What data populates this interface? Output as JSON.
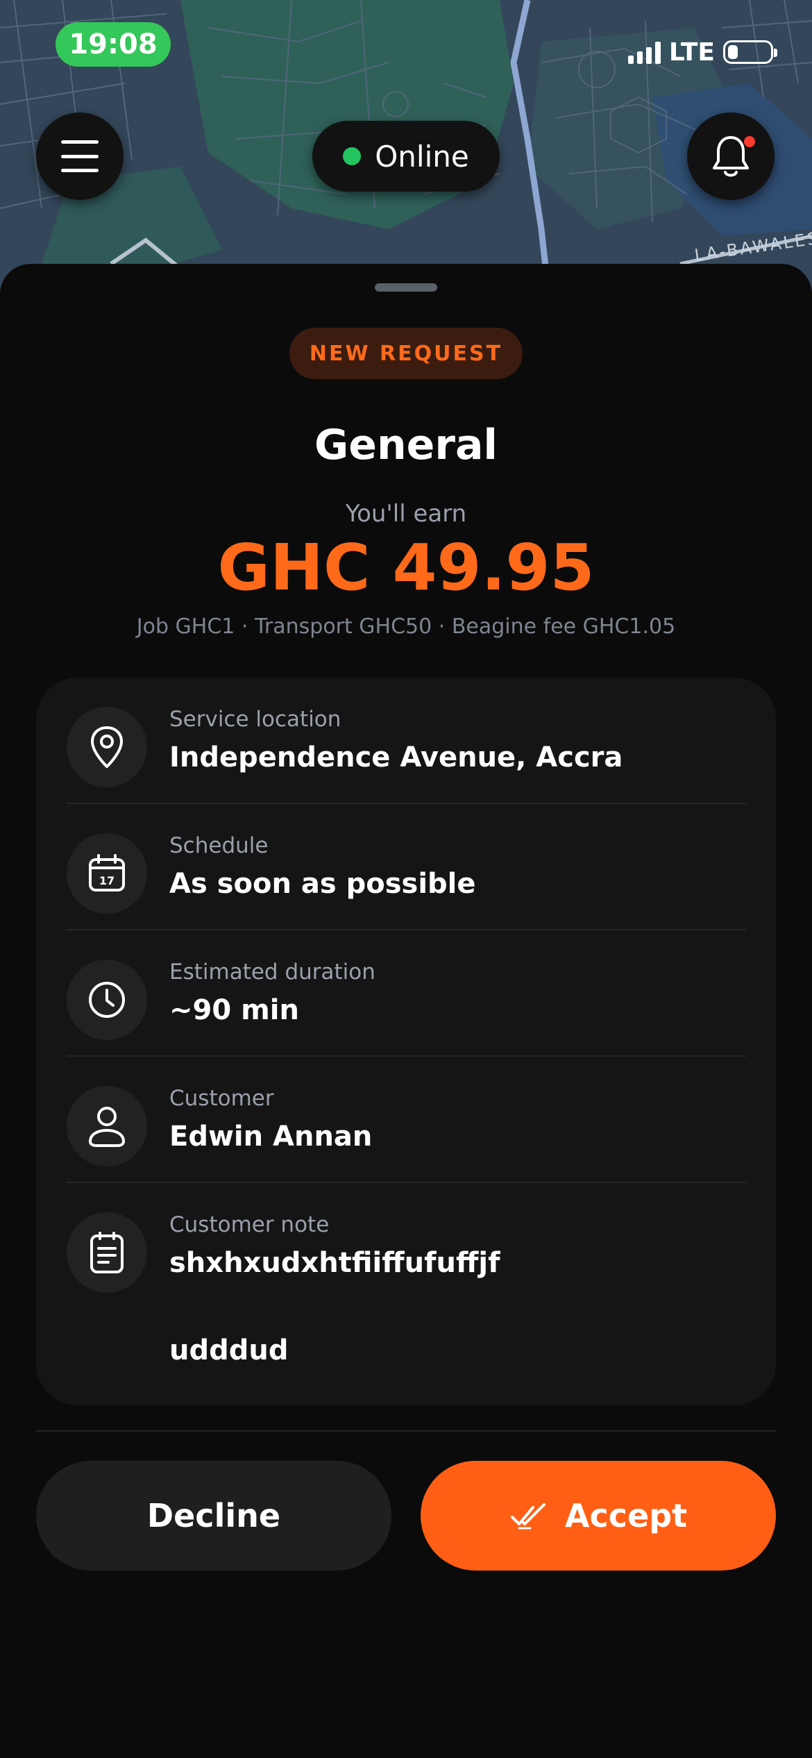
{
  "status_bar": {
    "time": "19:08",
    "network": "LTE"
  },
  "map": {
    "area_label": "LA-BAWALES"
  },
  "top": {
    "status_label": "Online",
    "status_color": "#22c55e"
  },
  "request": {
    "badge": "NEW REQUEST",
    "service": "General",
    "earn_label": "You'll earn",
    "earn_amount": "GHC 49.95",
    "breakdown": "Job GHC1 · Transport GHC50 · Beagine fee GHC1.05"
  },
  "details": [
    {
      "icon": "location-pin-icon",
      "label": "Service location",
      "value": "Independence Avenue, Accra"
    },
    {
      "icon": "calendar-icon",
      "label": "Schedule",
      "value": "As soon as possible"
    },
    {
      "icon": "clock-icon",
      "label": "Estimated duration",
      "value": "~90 min"
    },
    {
      "icon": "user-icon",
      "label": "Customer",
      "value": "Edwin Annan"
    },
    {
      "icon": "note-icon",
      "label": "Customer note",
      "value": "shxhxudxhtfiiffufuffjf",
      "value_line2": "udddud"
    }
  ],
  "actions": {
    "decline": "Decline",
    "accept": "Accept"
  },
  "colors": {
    "accent": "#ff5f14",
    "badge_bg": "#3b1c0f",
    "card_bg": "#151515"
  }
}
